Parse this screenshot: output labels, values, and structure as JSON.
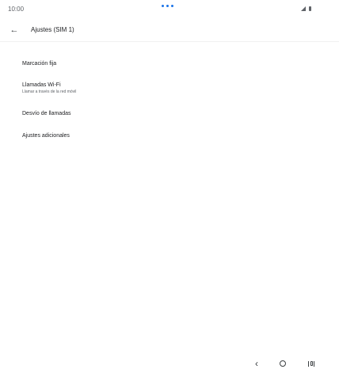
{
  "status_bar": {
    "time": "10:00"
  },
  "app_bar": {
    "title": "Ajustes (SIM 1)"
  },
  "items": [
    {
      "title": "Marcación fija"
    },
    {
      "title": "Llamadas Wi-Fi",
      "subtitle": "Llamar a través de la red móvil"
    },
    {
      "title": "Desvío de llamadas"
    },
    {
      "title": "Ajustes adicionales"
    }
  ],
  "icons": {
    "back": "arrow-left",
    "nav_back": "chevron-left",
    "nav_home": "circle",
    "nav_recents": "recents"
  },
  "colors": {
    "accent": "#1a73e8",
    "text": "#202124",
    "secondary": "#5f6368"
  }
}
